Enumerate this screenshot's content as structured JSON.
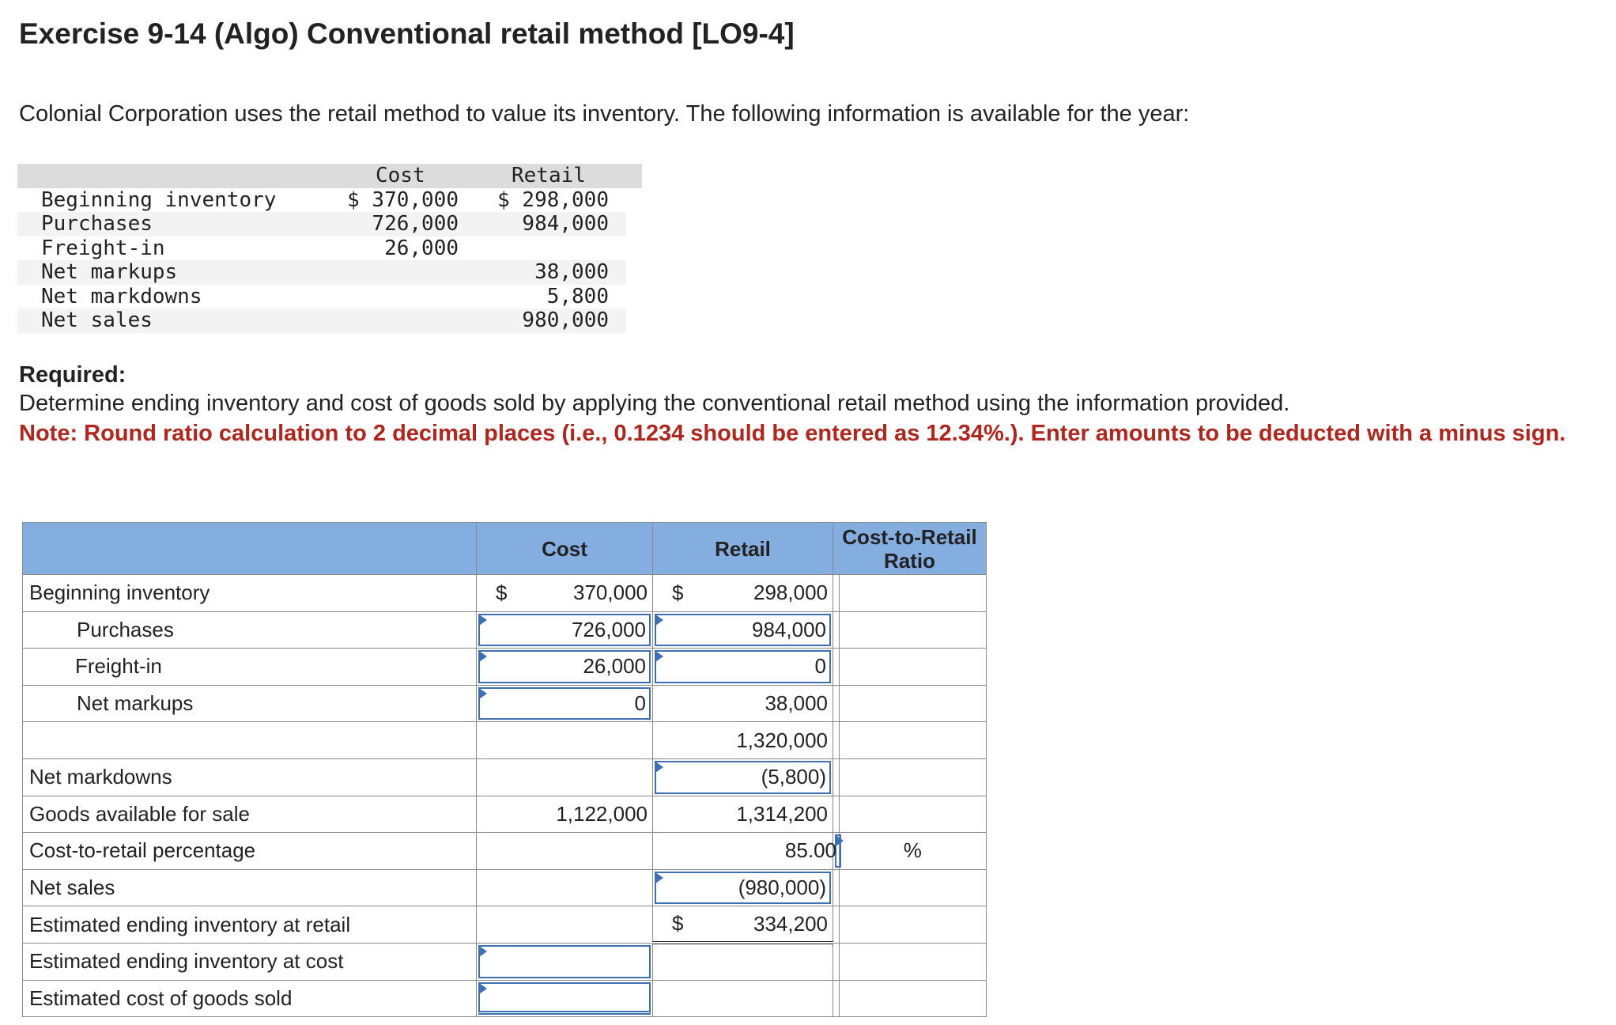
{
  "title": "Exercise 9-14 (Algo) Conventional retail method [LO9-4]",
  "intro": "Colonial Corporation uses the retail method to value its inventory. The following information is available for the year:",
  "given": {
    "headers": {
      "cost": "Cost",
      "retail": "Retail"
    },
    "rows": [
      {
        "label": "Beginning inventory",
        "cost": "$ 370,000",
        "retail": "$ 298,000"
      },
      {
        "label": "Purchases",
        "cost": "726,000",
        "retail": "984,000"
      },
      {
        "label": "Freight-in",
        "cost": "26,000",
        "retail": ""
      },
      {
        "label": "Net markups",
        "cost": "",
        "retail": "38,000"
      },
      {
        "label": "Net markdowns",
        "cost": "",
        "retail": "5,800"
      },
      {
        "label": "Net sales",
        "cost": "",
        "retail": "980,000"
      }
    ]
  },
  "required": {
    "heading": "Required:",
    "text": "Determine ending inventory and cost of goods sold by applying the conventional retail method using the information provided.",
    "note": "Note: Round ratio calculation to 2 decimal places (i.e., 0.1234 should be entered as 12.34%.). Enter amounts to be deducted with a minus sign."
  },
  "table": {
    "headers": {
      "cost": "Cost",
      "retail": "Retail",
      "ratio": "Cost-to-Retail Ratio"
    },
    "currency": "$",
    "percent": "%",
    "rows": [
      {
        "label": "Beginning inventory",
        "cost": "370,000",
        "retail": "298,000",
        "ratio": ""
      },
      {
        "label": "Purchases",
        "cost": "726,000",
        "retail": "984,000",
        "ratio": ""
      },
      {
        "label": "Freight-in",
        "cost": "26,000",
        "retail": "0",
        "ratio": ""
      },
      {
        "label": "Net markups",
        "cost": "0",
        "retail": "38,000",
        "ratio": ""
      },
      {
        "label": "",
        "cost": "",
        "retail": "1,320,000",
        "ratio": ""
      },
      {
        "label": "Net markdowns",
        "cost": "",
        "retail": "(5,800)",
        "ratio": ""
      },
      {
        "label": "Goods available for sale",
        "cost": "1,122,000",
        "retail": "1,314,200",
        "ratio": ""
      },
      {
        "label": "Cost-to-retail percentage",
        "cost": "",
        "retail": "",
        "ratio": "85.00"
      },
      {
        "label": "Net sales",
        "cost": "",
        "retail": "(980,000)",
        "ratio": ""
      },
      {
        "label": "Estimated ending inventory at retail",
        "cost": "",
        "retail": "334,200",
        "ratio": ""
      },
      {
        "label": "Estimated ending inventory at cost",
        "cost": "",
        "retail": "",
        "ratio": ""
      },
      {
        "label": "Estimated cost of goods sold",
        "cost": "",
        "retail": "",
        "ratio": ""
      }
    ]
  },
  "colors": {
    "header_bg": "#84ade0",
    "input_border": "#3d6fb5",
    "note": "#b0261c"
  }
}
